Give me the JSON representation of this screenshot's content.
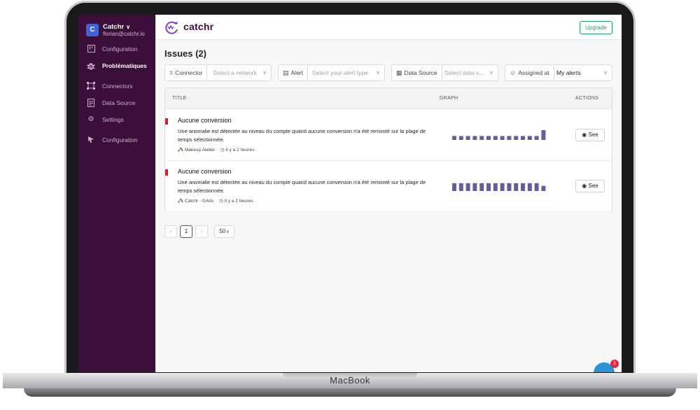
{
  "device": {
    "label": "MacBook"
  },
  "account": {
    "initial": "C",
    "name": "Catchr",
    "email": "florian@catchr.io"
  },
  "sidebar": {
    "items": [
      {
        "label": "Configuration",
        "icon": "board-icon",
        "active": false
      },
      {
        "label": "Problématiques",
        "icon": "bug-icon",
        "active": true
      },
      {
        "label": "Connectors",
        "icon": "connector-icon",
        "active": false
      },
      {
        "label": "Data Source",
        "icon": "data-source-icon",
        "active": false
      },
      {
        "label": "Settings",
        "icon": "gear-icon",
        "active": false
      },
      {
        "label": "Configuration",
        "icon": "pointer-icon",
        "active": false
      }
    ]
  },
  "header": {
    "logo_text": "catchr",
    "upgrade_label": "Upgrade"
  },
  "page": {
    "title": "Issues (2)"
  },
  "filters": {
    "connector": {
      "label": "Connector",
      "placeholder": "Select a network"
    },
    "alert": {
      "label": "Alert",
      "placeholder": "Select your alert type"
    },
    "data_source": {
      "label": "Data Source",
      "placeholder": "Select data s..."
    },
    "assigned": {
      "label": "Assigned at",
      "value": "My alerts"
    }
  },
  "table": {
    "columns": {
      "title": "TITLE",
      "graph": "GRAPH",
      "actions": "ACTIONS"
    },
    "rows": [
      {
        "title": "Aucune conversion",
        "description": "Une anomalie est détectée au niveau du compte quand aucune conversion n'a été remonté sur la plage de temps sélectionnée.",
        "source": "Makeup Atelier",
        "time": "Il y a 2 heures",
        "action": "See",
        "graph": [
          1,
          1,
          1,
          1,
          1,
          1,
          1,
          1,
          1,
          1,
          1,
          1,
          1,
          2.5
        ]
      },
      {
        "title": "Aucune conversion",
        "description": "Une anomalie est détectée au niveau du compte quand aucune conversion n'a été remonté sur la plage de temps sélectionnée.",
        "source": "Catchr - GAds",
        "time": "Il y a 2 heures",
        "action": "See",
        "graph": [
          2,
          2,
          2,
          2,
          2,
          2,
          2,
          2,
          2,
          2,
          2,
          2,
          2,
          1.3
        ]
      }
    ]
  },
  "pagination": {
    "prev": "‹",
    "current": "1",
    "next": "›",
    "page_size": "50"
  },
  "chat": {
    "badge": "1"
  },
  "colors": {
    "sidebar": "#3b0f3a",
    "accent": "#17a86b",
    "bar": "#6b5b9a",
    "flag": "#e01b2f"
  }
}
